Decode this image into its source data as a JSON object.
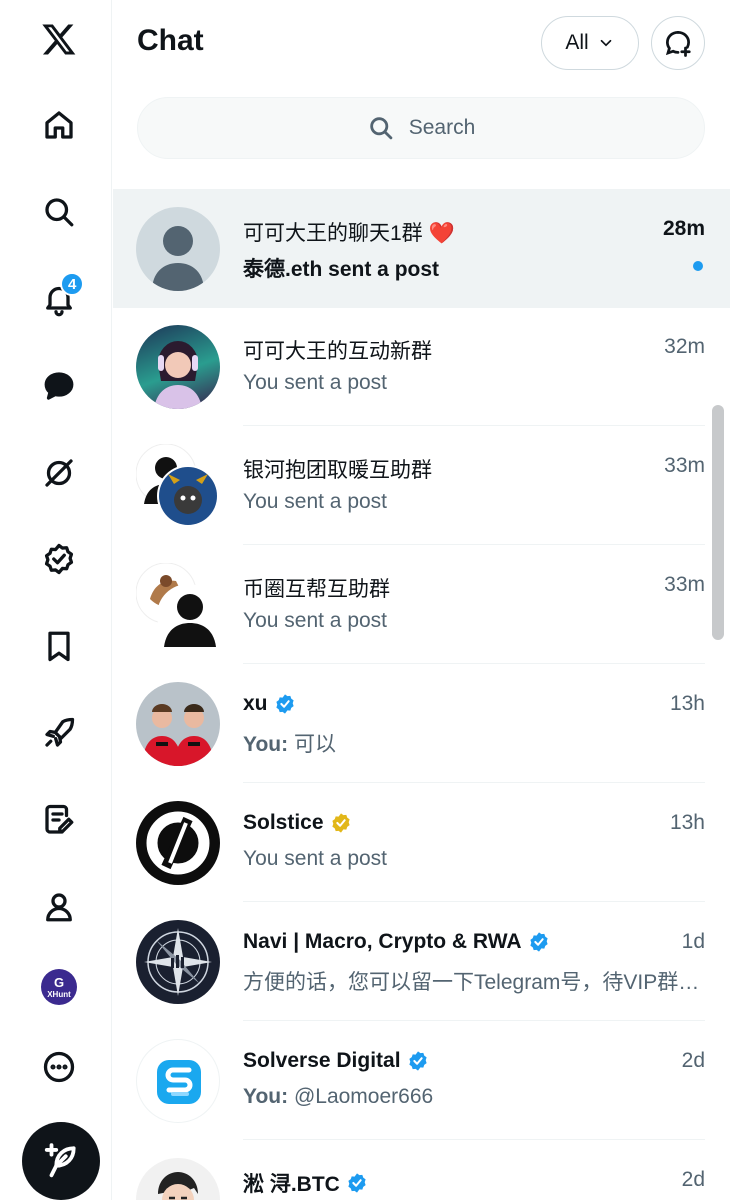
{
  "nav": {
    "notifications_count": "4",
    "xhunt_label": "XHunt"
  },
  "header": {
    "title": "Chat",
    "filter_label": "All"
  },
  "search": {
    "placeholder": "Search"
  },
  "conversations": [
    {
      "name": "可可大王的聊天1群 ❤️",
      "time": "28m",
      "preview": "泰德.eth sent a post",
      "unread": true,
      "verified": "none"
    },
    {
      "name": "可可大王的互动新群",
      "time": "32m",
      "preview": "You sent a post",
      "unread": false,
      "verified": "none"
    },
    {
      "name": "银河抱团取暖互助群",
      "time": "33m",
      "preview": "You sent a post",
      "unread": false,
      "verified": "none"
    },
    {
      "name": "币圈互帮互助群",
      "time": "33m",
      "preview": "You sent a post",
      "unread": false,
      "verified": "none"
    },
    {
      "name": "xu",
      "time": "13h",
      "preview_prefix": "You:",
      "preview": "可以",
      "unread": false,
      "verified": "blue"
    },
    {
      "name": "Solstice",
      "time": "13h",
      "preview": "You sent a post",
      "unread": false,
      "verified": "gold"
    },
    {
      "name": "Navi | Macro, Crypto & RWA",
      "time": "1d",
      "preview": "方便的话，您可以留一下Telegram号，待VIP群开放后我们第一时间拉您进群",
      "unread": false,
      "verified": "blue"
    },
    {
      "name": "Solverse Digital",
      "time": "2d",
      "preview_prefix": "You:",
      "preview": "@Laomoer666",
      "unread": false,
      "verified": "blue"
    },
    {
      "name": "淞 浔.BTC",
      "time": "2d",
      "preview": "",
      "unread": false,
      "verified": "blue"
    }
  ],
  "colors": {
    "accent": "#1d9bf0",
    "gold": "#e2b719",
    "text": "#0f1419",
    "muted": "#536471"
  }
}
